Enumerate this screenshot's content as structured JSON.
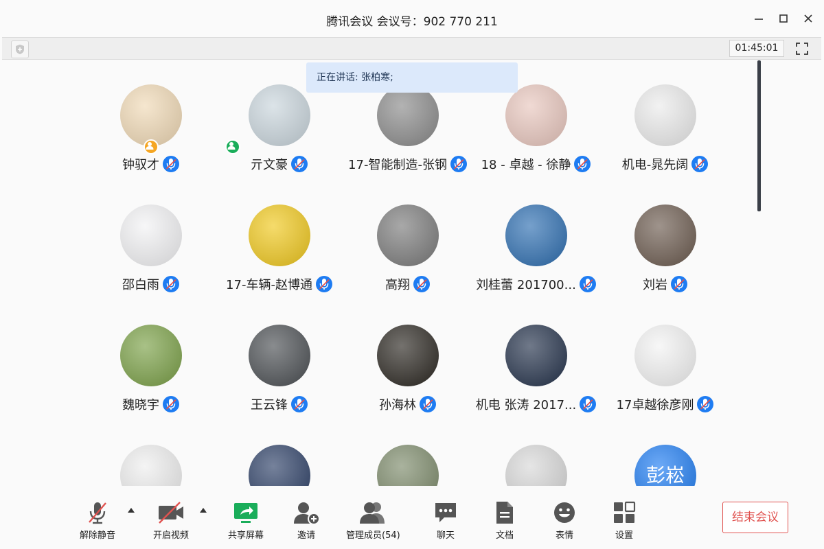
{
  "window": {
    "title": "腾讯会议 会议号：902 770 211",
    "timer": "01:45:01"
  },
  "speaker_banner": "正在讲话: 张柏寒;",
  "participants": [
    {
      "name": "钟驭才",
      "avatar_color": "#f0d9b5",
      "badge": "host"
    },
    {
      "name": "亓文豪",
      "avatar_color": "#c9d5dc",
      "badge": "cohost"
    },
    {
      "name": "17-智能制造-张钢",
      "avatar_color": "#8a8a8a"
    },
    {
      "name": "18 - 卓越 - 徐静",
      "avatar_color": "#e8c6bd"
    },
    {
      "name": "机电-晁先阔",
      "avatar_color": "#ebebeb"
    },
    {
      "name": "邵白雨",
      "avatar_color": "#f2f2f4"
    },
    {
      "name": "17-车辆-赵博通",
      "avatar_color": "#f0c81c"
    },
    {
      "name": "高翔",
      "avatar_color": "#7a7a7a"
    },
    {
      "name": "刘桂蕾  201700...",
      "avatar_color": "#2c6db0"
    },
    {
      "name": "刘岩",
      "avatar_color": "#6b5a4e"
    },
    {
      "name": "魏晓宇",
      "avatar_color": "#7aa046"
    },
    {
      "name": "王云锋",
      "avatar_color": "#4a4e52"
    },
    {
      "name": "孙海林",
      "avatar_color": "#2a2620"
    },
    {
      "name": "机电 张涛 2017...",
      "avatar_color": "#23314a"
    },
    {
      "name": "17卓越徐彦刚",
      "avatar_color": "#f3f3f3"
    },
    {
      "name": "",
      "avatar_color": "#eeeeee"
    },
    {
      "name": "",
      "avatar_color": "#2c3f66"
    },
    {
      "name": "",
      "avatar_color": "#7c8a6a"
    },
    {
      "name": "",
      "avatar_color": "#d8d8d8"
    },
    {
      "name": "",
      "avatar_color": "#1e7cf2",
      "avatar_text": "彭崧"
    }
  ],
  "toolbar": {
    "mute": "解除静音",
    "video": "开启视频",
    "share": "共享屏幕",
    "invite": "邀请",
    "members": "管理成员(54)",
    "chat": "聊天",
    "docs": "文档",
    "emoji": "表情",
    "settings": "设置",
    "end": "结束会议"
  },
  "colors": {
    "accent": "#1e7cf2",
    "end_red": "#e0524f",
    "share_green": "#1aad5a",
    "banner_bg": "#dce9fb"
  }
}
